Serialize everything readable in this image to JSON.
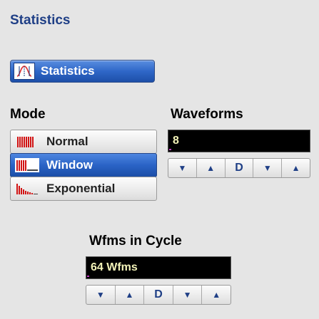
{
  "panel": {
    "title": "Statistics"
  },
  "statistics_button": {
    "label": "Statistics"
  },
  "mode": {
    "label": "Mode",
    "options": [
      {
        "label": "Normal",
        "selected": false
      },
      {
        "label": "Window",
        "selected": true
      },
      {
        "label": "Exponential",
        "selected": false
      }
    ]
  },
  "waveforms": {
    "label": "Waveforms",
    "value": "8",
    "buttons": [
      "▼",
      "▲",
      "D",
      "▼",
      "▲"
    ]
  },
  "wfms_in_cycle": {
    "label": "Wfms in Cycle",
    "value": "64 Wfms",
    "buttons": [
      "▼",
      "▲",
      "D",
      "▼",
      "▲"
    ]
  },
  "colors": {
    "title": "#1f3f86",
    "selected": "#2a63c6",
    "icon_red": "#d21414"
  }
}
